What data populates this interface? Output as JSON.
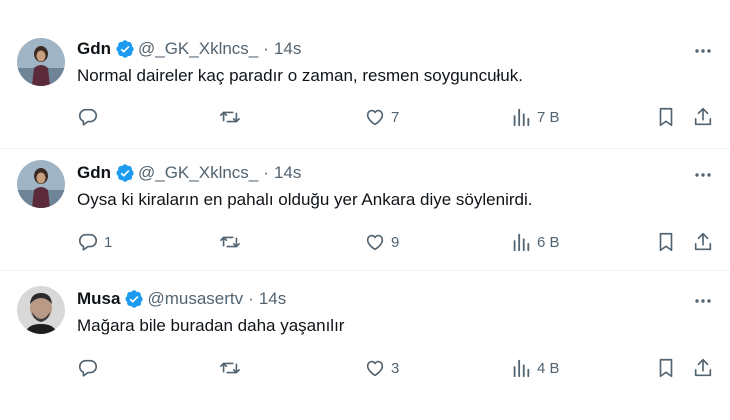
{
  "tweets": [
    {
      "name": "Gdn",
      "handle": "@_GK_Xklncs_",
      "separator": "·",
      "time": "14s",
      "text": "Normal daireler kaç paradır o zaman, resmen soyguncułuk.",
      "replies": "",
      "retweets": "",
      "likes": "7",
      "views": "7 B"
    },
    {
      "name": "Gdn",
      "handle": "@_GK_Xklncs_",
      "separator": "·",
      "time": "14s",
      "text": "Oysa ki kiraların en pahalı olduğu yer Ankara diye söylenirdi.",
      "replies": "1",
      "retweets": "",
      "likes": "9",
      "views": "6 B"
    },
    {
      "name": "Musa",
      "handle": "@musasertv",
      "separator": "·",
      "time": "14s",
      "text": "Mağara bile buradan daha yaşanılır",
      "replies": "",
      "retweets": "",
      "likes": "3",
      "views": "4 B"
    }
  ],
  "colors": {
    "text": "#0f1419",
    "secondary": "#536471",
    "verified": "#1d9bf0",
    "divider": "#eff3f4"
  },
  "icons": [
    "verified-badge-icon",
    "more-icon",
    "reply-icon",
    "retweet-icon",
    "like-icon",
    "views-icon",
    "bookmark-icon",
    "share-icon"
  ]
}
